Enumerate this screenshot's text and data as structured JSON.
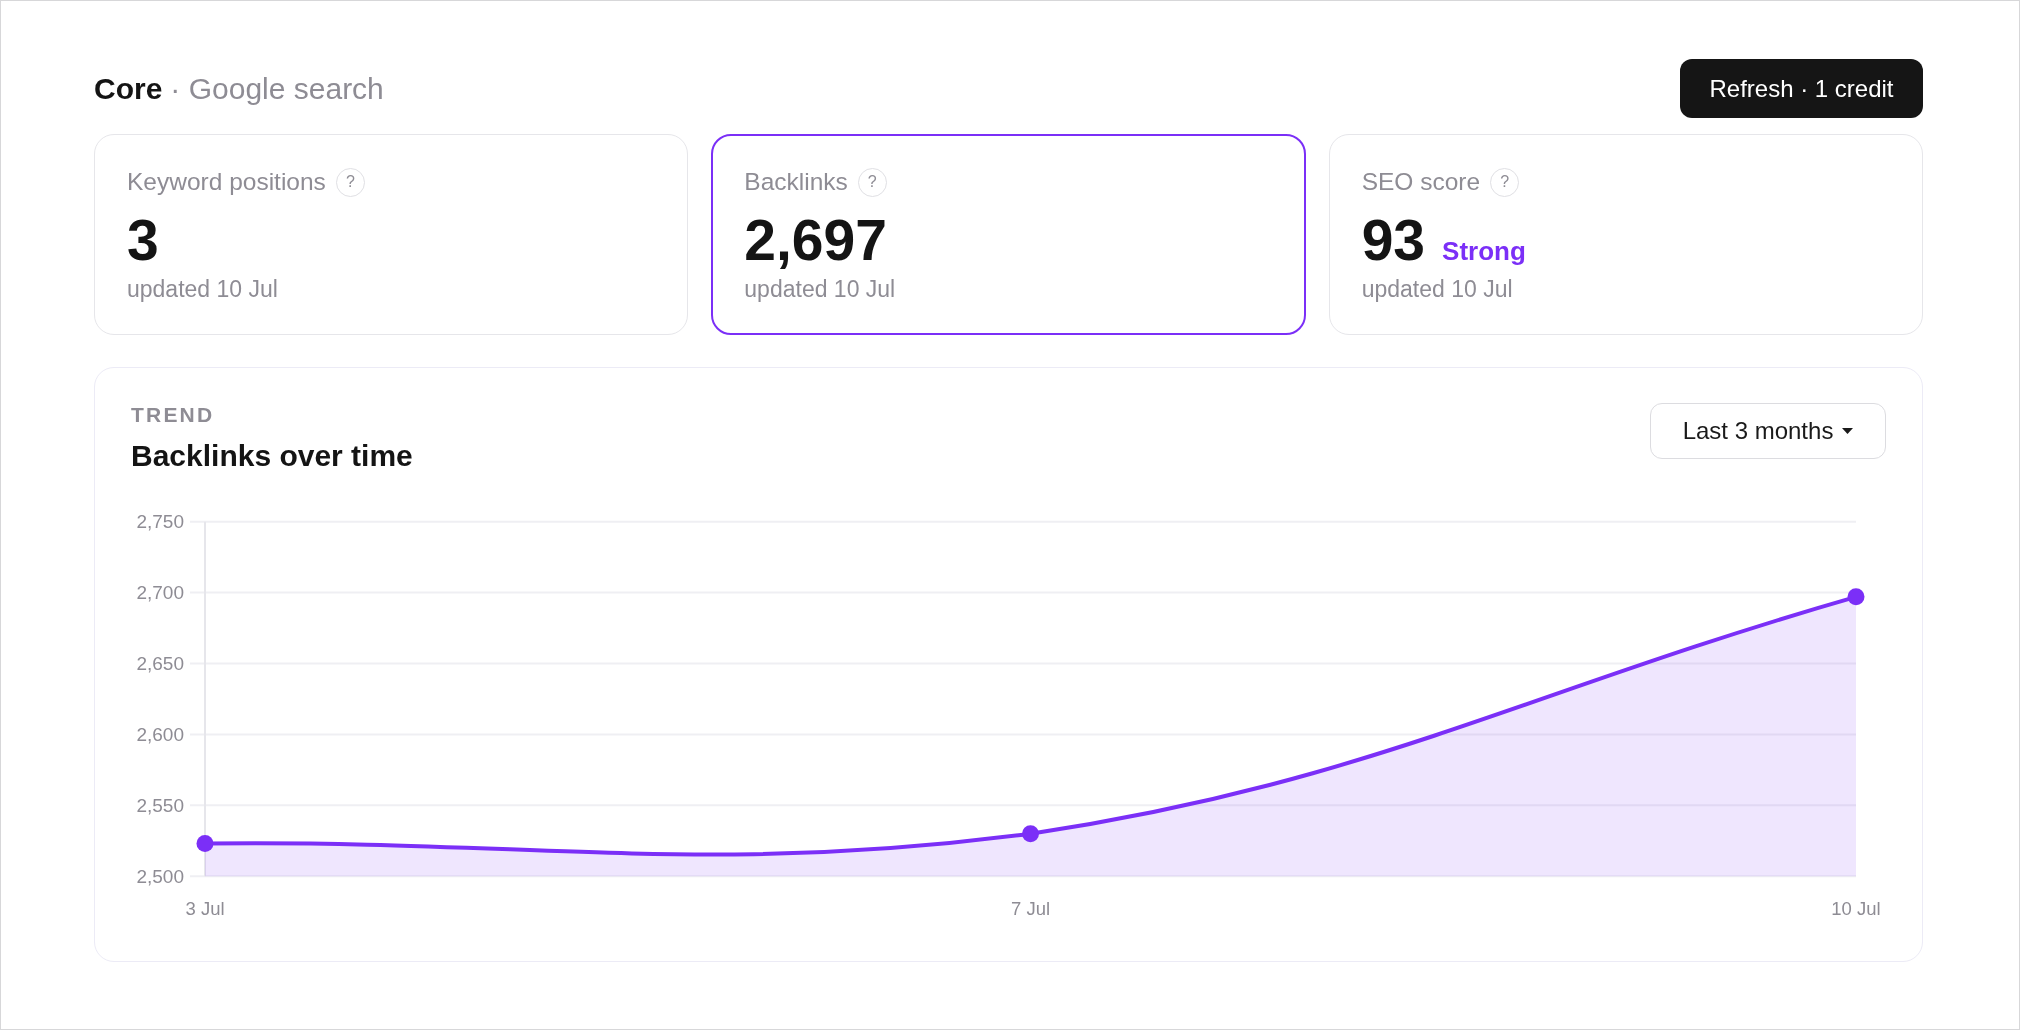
{
  "header": {
    "title": "Core",
    "context": "· Google search"
  },
  "refresh_button": {
    "label": "Refresh · 1 credit"
  },
  "metrics": [
    {
      "label": "Keyword positions",
      "help": "?",
      "value": "3",
      "updated": "updated 10 Jul",
      "selected": false
    },
    {
      "label": "Backlinks",
      "help": "?",
      "value": "2,697",
      "updated": "updated 10 Jul",
      "selected": true
    },
    {
      "label": "SEO score",
      "help": "?",
      "value": "93",
      "rating": "Strong",
      "updated": "updated 10 Jul",
      "selected": false
    }
  ],
  "trend": {
    "eyebrow": "TREND",
    "title": "Backlinks over time",
    "range": {
      "label": "Last 3 months"
    },
    "chart_data": {
      "type": "area",
      "grid": true,
      "categories": [
        "3 Jul",
        "7 Jul",
        "10 Jul"
      ],
      "series": [
        {
          "color": "#7b2ff7",
          "values": [
            2523,
            2530,
            2697
          ]
        }
      ],
      "ylim": [
        2500,
        2750
      ],
      "yticks": [
        {
          "value": 2500,
          "label": "2,500"
        },
        {
          "value": 2550,
          "label": "2,550"
        },
        {
          "value": 2600,
          "label": "2,600"
        },
        {
          "value": 2650,
          "label": "2,650"
        },
        {
          "value": 2700,
          "label": "2,700"
        },
        {
          "value": 2750,
          "label": "2,750"
        }
      ]
    }
  }
}
